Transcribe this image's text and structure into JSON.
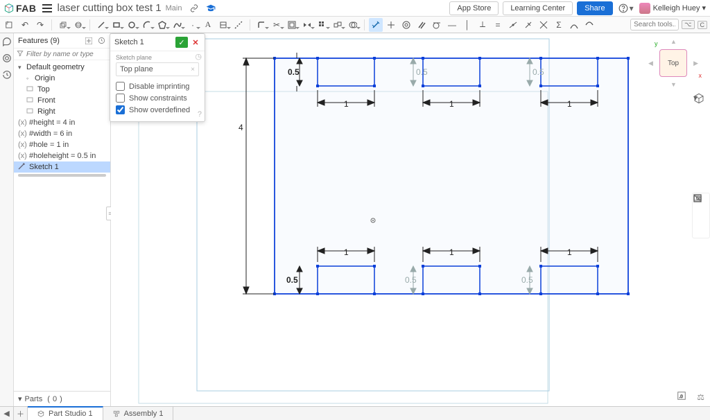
{
  "header": {
    "logo": "FAB",
    "doc_title": "laser cutting box test 1",
    "branch": "Main",
    "app_store": "App Store",
    "learning_center": "Learning Center",
    "share": "Share",
    "user_name": "Kelleigh Huey"
  },
  "search": {
    "placeholder": "Search tools...",
    "shortcut1": "⌥",
    "shortcut2": "C"
  },
  "features": {
    "header": "Features",
    "count": "9",
    "filter_placeholder": "Filter by name or type",
    "default_geometry": "Default geometry",
    "origin": "Origin",
    "planes": [
      "Top",
      "Front",
      "Right"
    ],
    "vars": [
      "#height = 4 in",
      "#width = 6 in",
      "#hole = 1 in",
      "#holeheight = 0.5 in"
    ],
    "sketch1": "Sketch 1"
  },
  "parts": {
    "label": "Parts",
    "count": "0"
  },
  "sketch_panel": {
    "title": "Sketch 1",
    "plane_label": "Sketch plane",
    "plane_value": "Top plane",
    "opt_imprint": "Disable imprinting",
    "opt_constraints": "Show constraints",
    "opt_overdefined": "Show overdefined"
  },
  "dimensions": {
    "height": "4",
    "notch_h_active": "0.5",
    "notch_h_faded": "0.5",
    "notch_w": "1"
  },
  "view_cube": {
    "face": "Top",
    "x": "x",
    "y": "y"
  },
  "tabs": {
    "part_studio": "Part Studio 1",
    "assembly": "Assembly 1"
  }
}
